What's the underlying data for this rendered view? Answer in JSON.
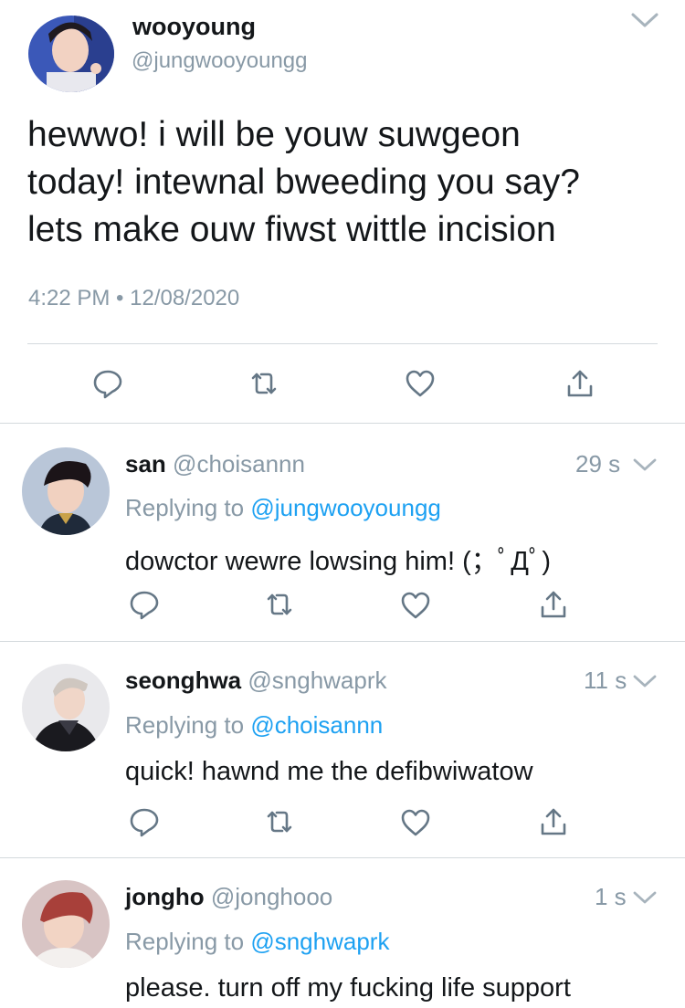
{
  "main_tweet": {
    "display_name": "wooyoung",
    "handle": "@jungwooyoungg",
    "text_lines": [
      "hewwo! i will be youw suwgeon",
      "today! intewnal bweeding you say?",
      "lets make ouw fiwst wittle incision"
    ],
    "timestamp": "4:22 PM • 12/08/2020",
    "menu_icon": "chevron-down-icon"
  },
  "replies": [
    {
      "display_name": "san",
      "handle": "@choisannn",
      "time": "29 s",
      "replying_prefix": "Replying to",
      "replying_to": "@jungwooyoungg",
      "text": "dowctor wewre lowsing him! (；ﾟДﾟ)"
    },
    {
      "display_name": "seonghwa",
      "handle": "@snghwaprk",
      "time": "11 s",
      "replying_prefix": "Replying to",
      "replying_to": "@choisannn",
      "text": "quick! hawnd me the defibwiwatow"
    },
    {
      "display_name": "jongho",
      "handle": "@jonghooo",
      "time": "1 s",
      "replying_prefix": "Replying to",
      "replying_to": "@snghwaprk",
      "text": "please. turn off my fucking life support"
    }
  ],
  "action_icons": [
    "reply-icon",
    "retweet-icon",
    "like-icon",
    "share-icon"
  ],
  "colors": {
    "text": "#14171a",
    "muted": "#8899a6",
    "link": "#1da1f2",
    "separator": "#d4d9dd"
  }
}
